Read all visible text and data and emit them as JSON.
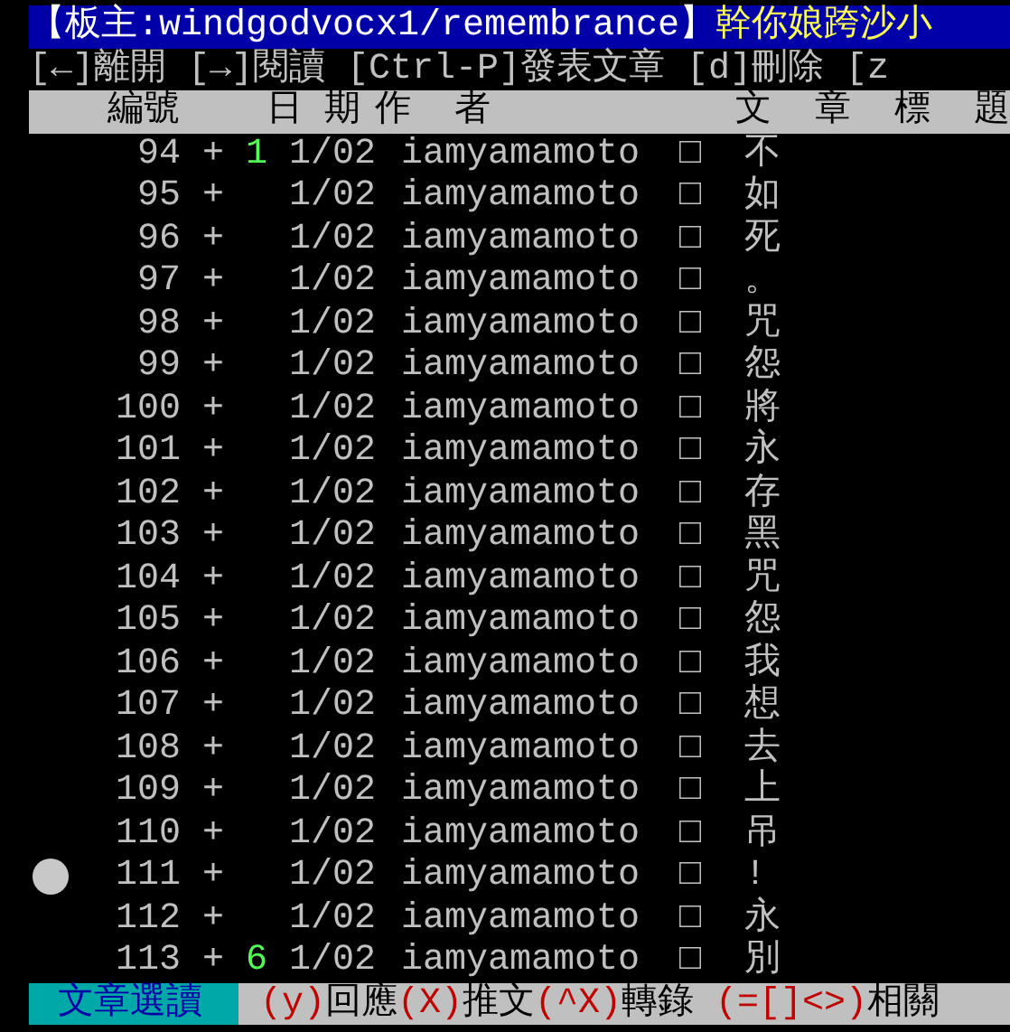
{
  "header": {
    "board_owner": "【板主:windgodvocx1/remembrance】",
    "board_title": "幹你娘跨沙小"
  },
  "help_bar": "[←]離開 [→]閱讀 [Ctrl-P]發表文章 [d]刪除 [z",
  "columns": [
    "編號",
    "日 期",
    "作  者",
    "文  章  標  題"
  ],
  "rows": [
    {
      "number": "94",
      "mark": "+",
      "count": "1",
      "date": "1/02",
      "author": "iamyamamoto",
      "box": "□",
      "title": "不",
      "selected": false
    },
    {
      "number": "95",
      "mark": "+",
      "count": "",
      "date": "1/02",
      "author": "iamyamamoto",
      "box": "□",
      "title": "如",
      "selected": false
    },
    {
      "number": "96",
      "mark": "+",
      "count": "",
      "date": "1/02",
      "author": "iamyamamoto",
      "box": "□",
      "title": "死",
      "selected": false
    },
    {
      "number": "97",
      "mark": "+",
      "count": "",
      "date": "1/02",
      "author": "iamyamamoto",
      "box": "□",
      "title": "。",
      "selected": false
    },
    {
      "number": "98",
      "mark": "+",
      "count": "",
      "date": "1/02",
      "author": "iamyamamoto",
      "box": "□",
      "title": "咒",
      "selected": false
    },
    {
      "number": "99",
      "mark": "+",
      "count": "",
      "date": "1/02",
      "author": "iamyamamoto",
      "box": "□",
      "title": "怨",
      "selected": false
    },
    {
      "number": "100",
      "mark": "+",
      "count": "",
      "date": "1/02",
      "author": "iamyamamoto",
      "box": "□",
      "title": "將",
      "selected": false
    },
    {
      "number": "101",
      "mark": "+",
      "count": "",
      "date": "1/02",
      "author": "iamyamamoto",
      "box": "□",
      "title": "永",
      "selected": false
    },
    {
      "number": "102",
      "mark": "+",
      "count": "",
      "date": "1/02",
      "author": "iamyamamoto",
      "box": "□",
      "title": "存",
      "selected": false
    },
    {
      "number": "103",
      "mark": "+",
      "count": "",
      "date": "1/02",
      "author": "iamyamamoto",
      "box": "□",
      "title": "黑",
      "selected": false
    },
    {
      "number": "104",
      "mark": "+",
      "count": "",
      "date": "1/02",
      "author": "iamyamamoto",
      "box": "□",
      "title": "咒",
      "selected": false
    },
    {
      "number": "105",
      "mark": "+",
      "count": "",
      "date": "1/02",
      "author": "iamyamamoto",
      "box": "□",
      "title": "怨",
      "selected": false
    },
    {
      "number": "106",
      "mark": "+",
      "count": "",
      "date": "1/02",
      "author": "iamyamamoto",
      "box": "□",
      "title": "我",
      "selected": false
    },
    {
      "number": "107",
      "mark": "+",
      "count": "",
      "date": "1/02",
      "author": "iamyamamoto",
      "box": "□",
      "title": "想",
      "selected": false
    },
    {
      "number": "108",
      "mark": "+",
      "count": "",
      "date": "1/02",
      "author": "iamyamamoto",
      "box": "□",
      "title": "去",
      "selected": false
    },
    {
      "number": "109",
      "mark": "+",
      "count": "",
      "date": "1/02",
      "author": "iamyamamoto",
      "box": "□",
      "title": "上",
      "selected": false
    },
    {
      "number": "110",
      "mark": "+",
      "count": "",
      "date": "1/02",
      "author": "iamyamamoto",
      "box": "□",
      "title": "吊",
      "selected": false
    },
    {
      "number": "111",
      "mark": "+",
      "count": "",
      "date": "1/02",
      "author": "iamyamamoto",
      "box": "□",
      "title": "!",
      "selected": true
    },
    {
      "number": "112",
      "mark": "+",
      "count": "",
      "date": "1/02",
      "author": "iamyamamoto",
      "box": "□",
      "title": "永",
      "selected": false
    },
    {
      "number": "113",
      "mark": "+",
      "count": "6",
      "date": "1/02",
      "author": "iamyamamoto",
      "box": "□",
      "title": "別",
      "selected": false
    }
  ],
  "footer": {
    "mode": "文章選讀",
    "hints": [
      {
        "kind": "key",
        "text": "(y)"
      },
      {
        "kind": "label",
        "text": "回應"
      },
      {
        "kind": "key",
        "text": "(X)"
      },
      {
        "kind": "label",
        "text": "推文"
      },
      {
        "kind": "key",
        "text": "(^X)"
      },
      {
        "kind": "label",
        "text": "轉錄"
      },
      {
        "kind": "key",
        "text": " (=[]<>)"
      },
      {
        "kind": "label",
        "text": "相關"
      }
    ]
  }
}
